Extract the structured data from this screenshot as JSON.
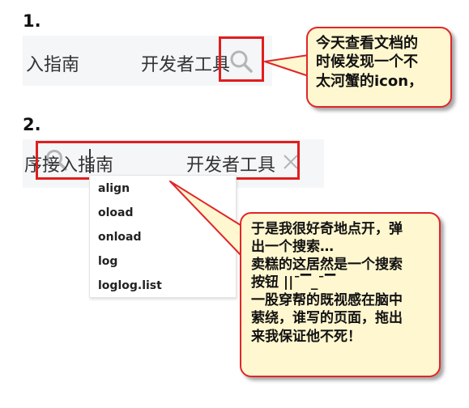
{
  "step1": {
    "label": "1.",
    "nav_left_text": "入指南",
    "nav_right_text": "开发者工具",
    "search_icon": "search-icon"
  },
  "step2": {
    "label": "2.",
    "input_value": "序接入指南",
    "nav_right_text": "开发者工具",
    "search_icon": "search-icon",
    "clear_icon": "close-icon",
    "suggestions": [
      "align",
      "oload",
      "onload",
      "log",
      "loglog.list"
    ]
  },
  "callout1": {
    "lines": [
      "今天查看文档的",
      "时候发现一个不",
      "太河蟹的icon，"
    ]
  },
  "callout2": {
    "lines": [
      "于是我很好奇地点开，弹",
      "出一个搜索…",
      "卖糕的这居然是一个搜索",
      "按钮  ||¯▔_¯▔",
      "一股穿帮的既视感在脑中",
      "萦绕，谁写的页面，拖出",
      "来我保证他不死！"
    ]
  },
  "colors": {
    "highlight": "#e11d1d",
    "callout_fill": "#fff7cf",
    "nav_bg": "#f4f6f8"
  }
}
